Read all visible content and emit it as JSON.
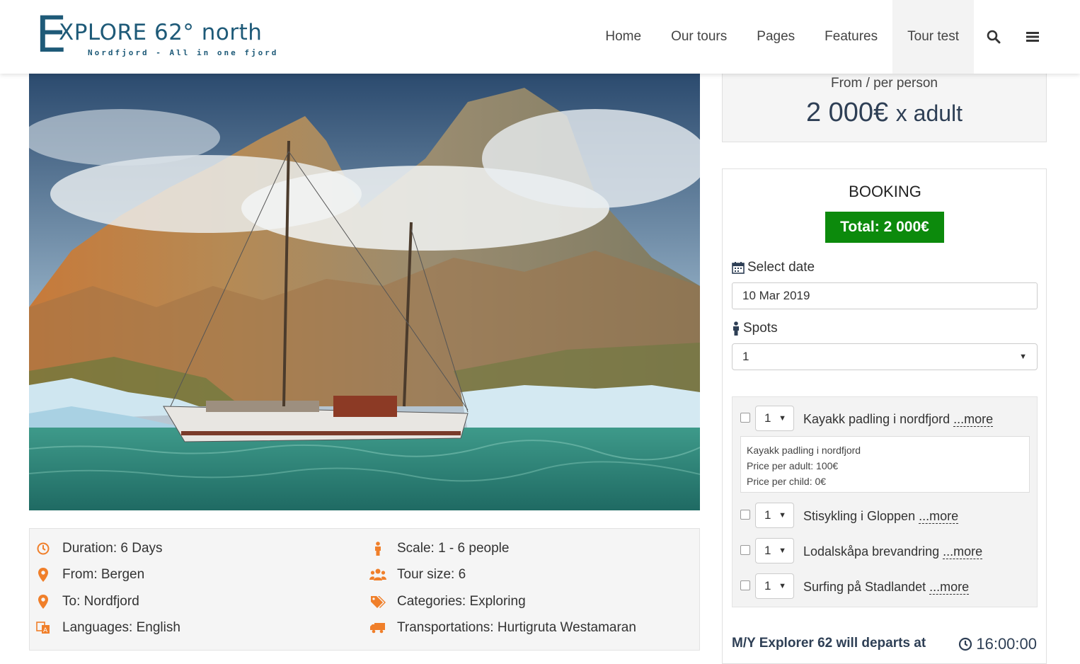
{
  "brand": {
    "big_letter": "E",
    "title": "XPLORE 62° north",
    "subtitle": "Nordfjord - All in one fjord",
    "color": "#1e5a78"
  },
  "nav": {
    "items": [
      {
        "label": "Home"
      },
      {
        "label": "Our tours"
      },
      {
        "label": "Pages"
      },
      {
        "label": "Features"
      },
      {
        "label": "Tour test"
      }
    ],
    "active": "Tour test",
    "search_icon": "search-icon",
    "menu_icon": "hamburger-menu-icon"
  },
  "hero": {
    "icon": "tour-photo-sailboat-mountain"
  },
  "tour_info": {
    "left": [
      {
        "icon": "clock-icon",
        "text": "Duration: 6 Days"
      },
      {
        "icon": "map-marker-icon",
        "text": "From: Bergen"
      },
      {
        "icon": "map-marker-icon",
        "text": "To: Nordfjord"
      },
      {
        "icon": "language-icon",
        "text": "Languages: English"
      }
    ],
    "right": [
      {
        "icon": "person-icon",
        "text": "Scale: 1 - 6 people"
      },
      {
        "icon": "group-icon",
        "text": "Tour size: 6"
      },
      {
        "icon": "tags-icon",
        "text": "Categories: Exploring"
      },
      {
        "icon": "truck-icon",
        "text": "Transportations: Hurtigruta Westamaran"
      }
    ],
    "icon_color": "#f07f2a"
  },
  "price": {
    "label": "From / per person",
    "amount": "2 000€",
    "unit": "x adult"
  },
  "booking": {
    "title": "BOOKING",
    "total": "Total: 2 000€",
    "total_color": "#0c8a0c",
    "date_label": "Select date",
    "date_value": "10 Mar 2019",
    "spots_label": "Spots",
    "spots_value": "1",
    "extras": [
      {
        "qty": "1",
        "name": "Kayakk padling i nordfjord",
        "more": "...more"
      },
      {
        "qty": "1",
        "name": "Stisykling i Gloppen",
        "more": "...more"
      },
      {
        "qty": "1",
        "name": "Lodalskåpa brevandring",
        "more": "...more"
      },
      {
        "qty": "1",
        "name": "Surfing på Stadlandet",
        "more": "...more"
      }
    ],
    "tooltip": {
      "line1": "Kayakk padling i nordfjord",
      "line2": "Price per adult: 100€",
      "line3": "Price per child: 0€"
    },
    "depart_text": "M/Y Explorer 62 will departs at",
    "depart_time": "16:00:00"
  }
}
